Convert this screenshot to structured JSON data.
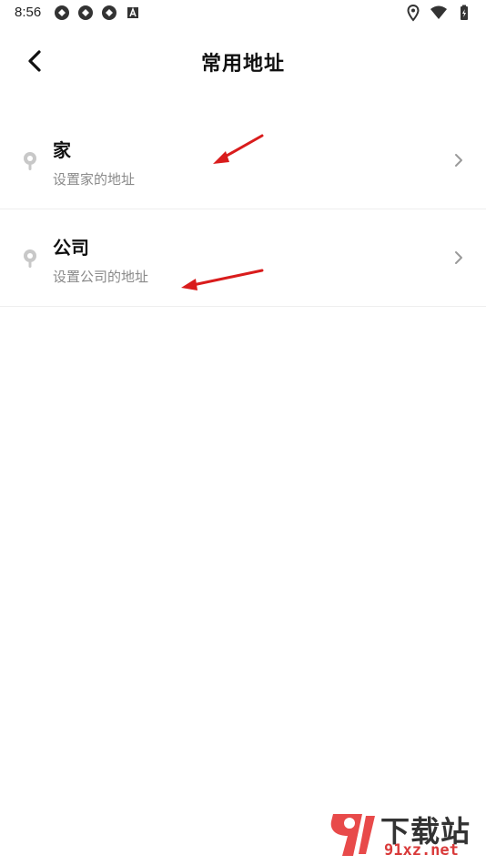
{
  "status_bar": {
    "time": "8:56",
    "left_icons": [
      "sync-icon",
      "sync-icon",
      "sync-icon",
      "a-badge-icon"
    ],
    "right_icons": [
      "location-icon",
      "wifi-icon",
      "battery-charging-icon"
    ]
  },
  "header": {
    "title": "常用地址",
    "back_icon": "back-arrow-icon"
  },
  "addresses": [
    {
      "title": "家",
      "subtitle": "设置家的地址",
      "icon": "location-pin-icon"
    },
    {
      "title": "公司",
      "subtitle": "设置公司的地址",
      "icon": "location-pin-icon"
    }
  ],
  "watermark": {
    "brand": "下载站",
    "domain": "91xz.net"
  },
  "colors": {
    "annotation_arrow": "#d91c1c",
    "subtitle_gray": "#8a8a8a",
    "pin_gray": "#c8c8c8",
    "divider": "#eeeeee"
  }
}
